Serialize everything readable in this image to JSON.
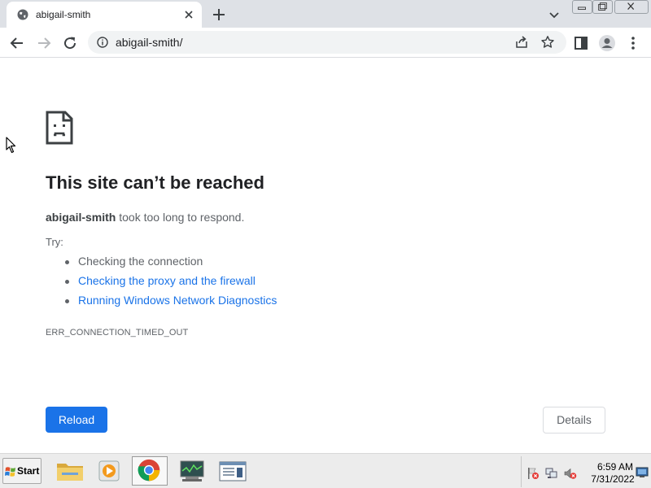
{
  "browser": {
    "tab": {
      "title": "abigail-smith",
      "favicon": "globe-icon"
    },
    "toolbar": {
      "url": "abigail-smith/",
      "icons": [
        "back-icon",
        "forward-icon",
        "reload-icon",
        "info-icon",
        "share-icon",
        "star-icon",
        "side-panel-icon",
        "profile-icon",
        "menu-icon"
      ]
    },
    "window_controls": [
      "minimize-icon",
      "restore-icon",
      "close-icon"
    ]
  },
  "error_page": {
    "icon": "sad-page-icon",
    "title": "This site can’t be reached",
    "host": "abigail-smith",
    "message": " took too long to respond.",
    "try_label": "Try:",
    "suggestions": [
      {
        "text": "Checking the connection",
        "link": false
      },
      {
        "text": "Checking the proxy and the firewall",
        "link": true
      },
      {
        "text": "Running Windows Network Diagnostics",
        "link": true
      }
    ],
    "error_code": "ERR_CONNECTION_TIMED_OUT",
    "reload_label": "Reload",
    "details_label": "Details"
  },
  "taskbar": {
    "start_label": "Start",
    "apps": [
      "file-explorer-icon",
      "media-player-icon",
      "chrome-icon",
      "task-manager-icon",
      "window-app-icon"
    ],
    "active_app": "chrome-icon",
    "tray_icons": [
      "network-error-icon",
      "network-icon",
      "volume-muted-icon",
      "desktop-icon"
    ],
    "clock_time": "6:59 AM",
    "clock_date": "7/31/2022"
  },
  "colors": {
    "accent": "#1a73e8",
    "link": "#1a73e8",
    "tabstrip": "#dee1e6",
    "taskbar": "#ececec"
  }
}
